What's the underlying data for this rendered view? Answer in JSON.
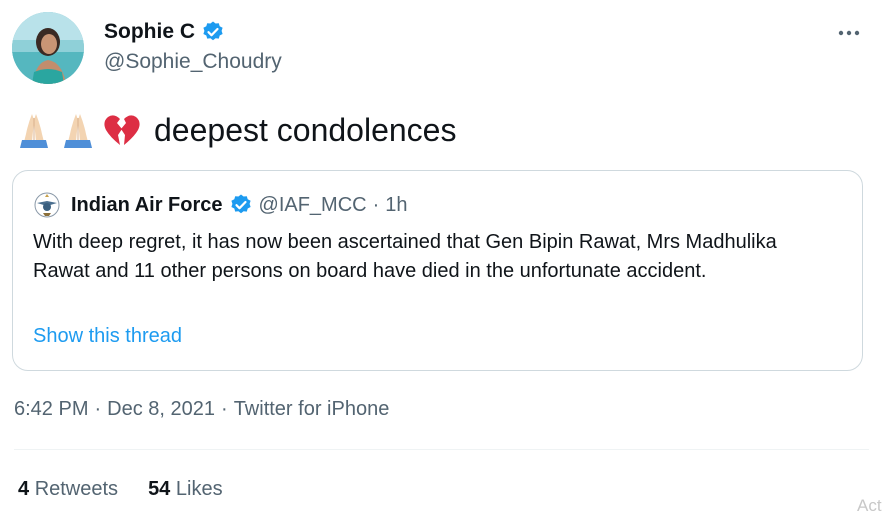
{
  "author": {
    "display_name": "Sophie C",
    "handle": "@Sophie_Choudry"
  },
  "tweet": {
    "emojis": [
      "folded-hands",
      "folded-hands",
      "broken-heart"
    ],
    "text": "deepest condolences"
  },
  "quoted_tweet": {
    "display_name": "Indian Air Force",
    "handle": "@IAF_MCC",
    "separator": "·",
    "time": "1h",
    "text": "With deep regret, it has now been ascertained that Gen Bipin Rawat, Mrs Madhulika Rawat and 11 other persons on board have died in the unfortunate accident.",
    "thread_link": "Show this thread"
  },
  "meta": {
    "time": "6:42 PM",
    "sep1": "·",
    "date": "Dec 8, 2021",
    "sep2": "·",
    "source": "Twitter for iPhone"
  },
  "stats": {
    "retweets_count": "4",
    "retweets_label": "Retweets",
    "likes_count": "54",
    "likes_label": "Likes"
  },
  "watermark": "Act",
  "colors": {
    "accent": "#1d9bf0",
    "muted": "#536471",
    "text": "#0f1419",
    "border": "#cfd9de"
  },
  "icons": {
    "verified": "verified-badge-icon",
    "more": "more-icon"
  }
}
